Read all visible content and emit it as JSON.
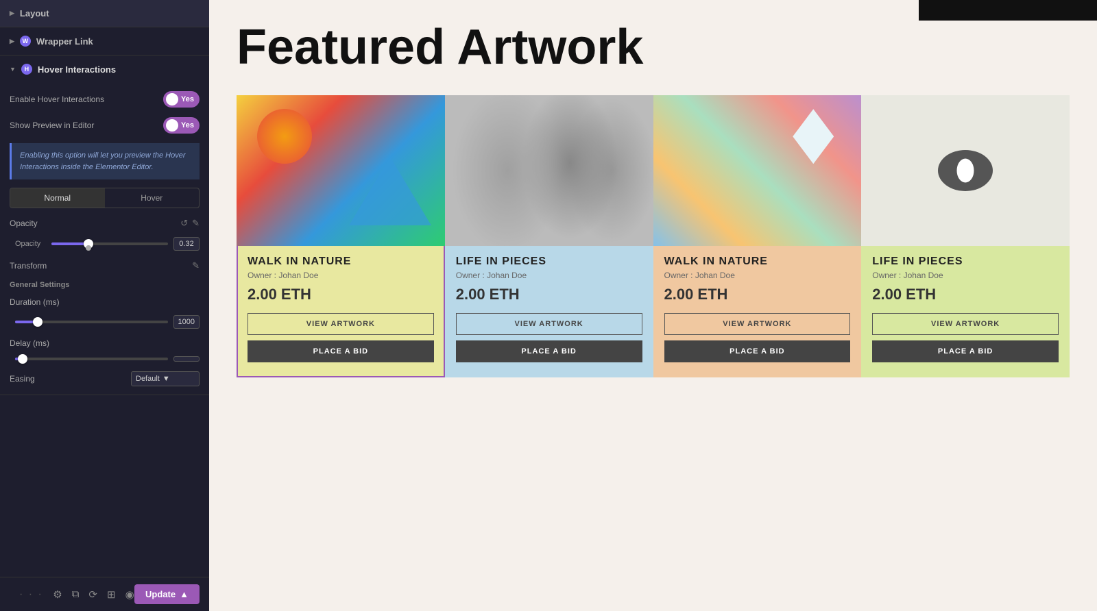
{
  "left_panel": {
    "sections": {
      "layout": {
        "label": "Layout",
        "collapsed": true
      },
      "wrapper_link": {
        "label": "Wrapper Link",
        "collapsed": true,
        "icon": "W"
      },
      "hover_interactions": {
        "label": "Hover Interactions",
        "collapsed": false,
        "icon": "H"
      }
    },
    "hover_interactions": {
      "enable_label": "Enable Hover Interactions",
      "enable_value": "Yes",
      "show_preview_label": "Show Preview in Editor",
      "show_preview_value": "Yes",
      "info_text": "Enabling this option will let you preview the Hover Interactions inside the Elementor Editor.",
      "mode_tabs": [
        "Normal",
        "Hover"
      ],
      "active_mode": "Normal",
      "opacity_label": "Opacity",
      "opacity_sublabel": "Opacity",
      "opacity_value": "0.32",
      "opacity_fill_percent": 32,
      "transform_label": "Transform",
      "general_settings_title": "General Settings",
      "duration_label": "Duration (ms)",
      "duration_value": "1000",
      "duration_fill_percent": 15,
      "delay_label": "Delay (ms)",
      "delay_value": "",
      "delay_fill_percent": 5,
      "easing_label": "Easing",
      "easing_value": "Default"
    },
    "toolbar": {
      "update_label": "Update"
    }
  },
  "right_content": {
    "page_title": "Featured Artwork",
    "cards": [
      {
        "id": 1,
        "title": "WALK IN NATURE",
        "owner": "Owner : Johan Doe",
        "price": "2.00 ETH",
        "btn_view": "VIEW ARTWORK",
        "btn_bid": "PLACE A BID",
        "selected": true,
        "bg_class": "card-bg-1"
      },
      {
        "id": 2,
        "title": "LIFE IN PIECES",
        "owner": "Owner : Johan Doe",
        "price": "2.00 ETH",
        "btn_view": "VIEW ARTWORK",
        "btn_bid": "PLACE A BID",
        "selected": false,
        "bg_class": "card-bg-2"
      },
      {
        "id": 3,
        "title": "WALK IN NATURE",
        "owner": "Owner : Johan Doe",
        "price": "2.00 ETH",
        "btn_view": "VIEW ARTWORK",
        "btn_bid": "PLACE A BID",
        "selected": false,
        "bg_class": "card-bg-3"
      },
      {
        "id": 4,
        "title": "LIFE IN PIECES",
        "owner": "Owner : Johan Doe",
        "price": "2.00 ETH",
        "btn_view": "VIEW ARTWORK",
        "btn_bid": "PLACE A BID",
        "selected": false,
        "bg_class": "card-bg-4"
      }
    ]
  },
  "icons": {
    "chevron_right": "▶",
    "chevron_down": "▼",
    "refresh": "↺",
    "edit": "✎",
    "dots": "···",
    "gear": "⚙",
    "layers": "⧉",
    "history": "⟳",
    "grid": "⊞",
    "eye": "◉",
    "chevron_up": "▲"
  }
}
